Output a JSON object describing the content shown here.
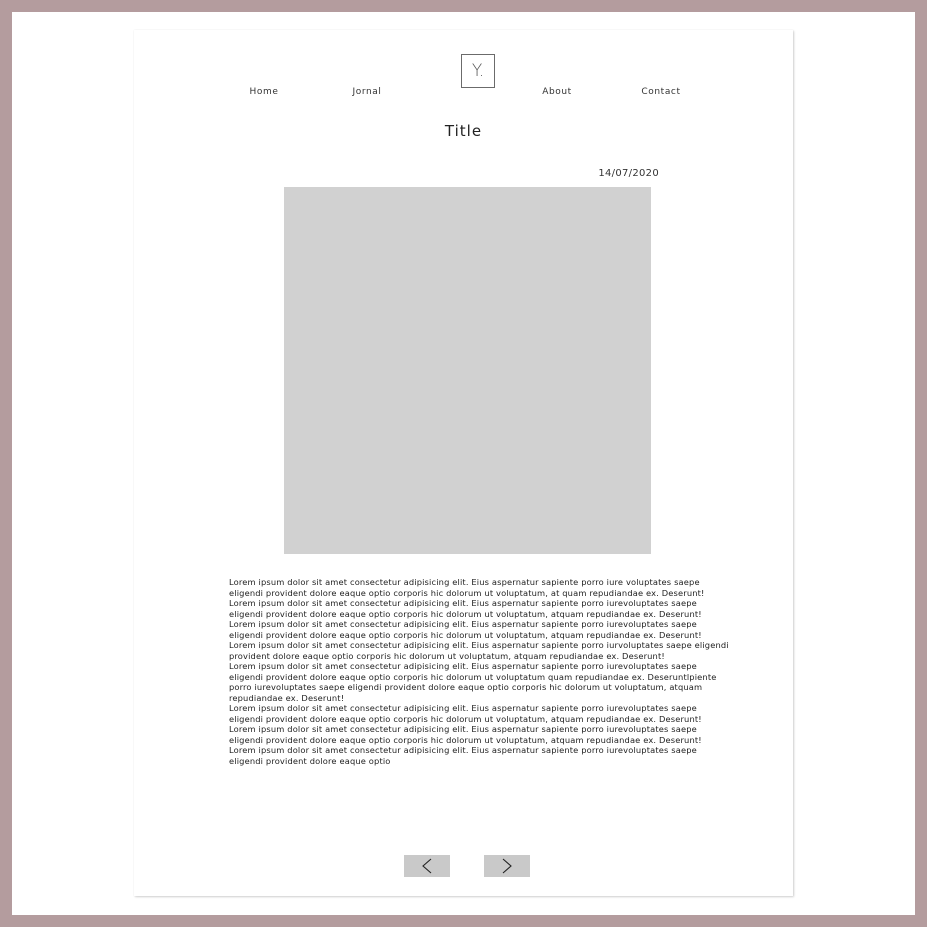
{
  "nav": {
    "home": "Home",
    "jornal": "Jornal",
    "about": "About",
    "contact": "Contact"
  },
  "logo": {
    "text": "Y."
  },
  "post": {
    "title": "Title",
    "date": "14/07/2020",
    "image_placeholder_color": "#d1d1d1",
    "paragraphs": [
      "Lorem ipsum dolor sit amet consectetur adipisicing elit. Eius aspernatur sapiente porro iure voluptates saepe eligendi provident dolore eaque optio corporis hic dolorum ut voluptatum, at quam repudiandae ex. Deserunt!",
      "Lorem ipsum dolor sit amet consectetur adipisicing elit. Eius aspernatur sapiente porro iurevoluptates saepe eligendi provident dolore eaque optio corporis hic dolorum ut voluptatum, atquam repudiandae ex. Deserunt!",
      "Lorem ipsum dolor sit amet consectetur adipisicing elit. Eius aspernatur sapiente porro iurevoluptates saepe eligendi provident dolore eaque optio corporis hic dolorum ut voluptatum, atquam repudiandae ex. Deserunt!",
      "Lorem ipsum dolor sit amet consectetur adipisicing elit. Eius aspernatur sapiente porro iurvoluptates saepe eligendi provident dolore eaque optio corporis hic dolorum ut voluptatum, atquam repudiandae ex. Deserunt!",
      "Lorem ipsum dolor sit amet consectetur adipisicing elit. Eius aspernatur sapiente porro iurevoluptates saepe eligendi provident dolore eaque optio corporis hic dolorum ut voluptatum quam repudiandae ex. Deseruntlpiente porro iurevoluptates saepe eligendi provident dolore eaque optio corporis hic dolorum ut voluptatum, atquam repudiandae ex. Deserunt!",
      "Lorem ipsum dolor sit amet consectetur adipisicing elit. Eius aspernatur sapiente porro iurevoluptates saepe eligendi provident dolore eaque optio corporis hic dolorum ut voluptatum, atquam repudiandae ex. Deserunt!",
      "Lorem ipsum dolor sit amet consectetur adipisicing elit. Eius aspernatur sapiente porro iurevoluptates saepe eligendi provident dolore eaque optio corporis hic dolorum ut voluptatum, atquam repudiandae ex. Deserunt!",
      "Lorem ipsum dolor sit amet consectetur adipisicing elit. Eius aspernatur sapiente porro iurevoluptates saepe eligendi provident dolore eaque optio"
    ]
  },
  "pager": {
    "prev_icon": "chevron-left-icon",
    "next_icon": "chevron-right-icon",
    "button_color": "#c9c9c9"
  },
  "colors": {
    "frame": "#b49c9e",
    "background": "#ffffff",
    "text": "#222222"
  }
}
